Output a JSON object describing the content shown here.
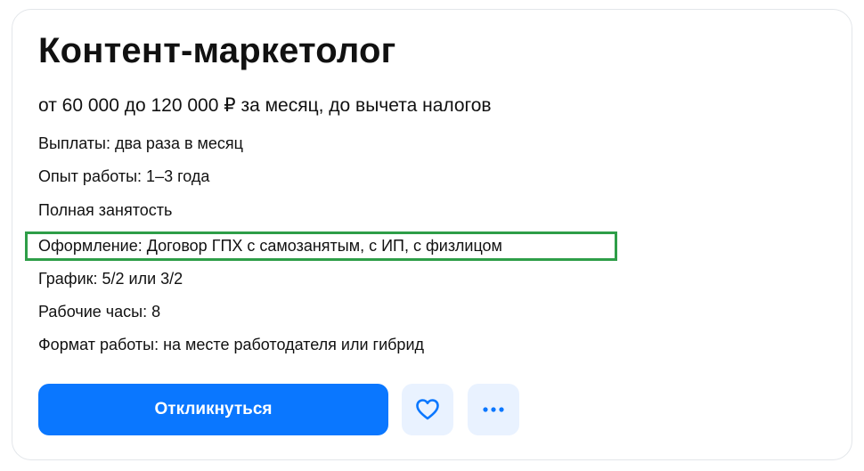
{
  "vacancy": {
    "title": "Контент-маркетолог",
    "salary": "от 60 000 до 120 000 ₽ за месяц, до вычета налогов",
    "details": [
      "Выплаты: два раза в месяц",
      "Опыт работы: 1–3 года",
      "Полная занятость",
      "Оформление: Договор ГПХ с самозанятым, с ИП, с физлицом",
      "График: 5/2 или 3/2",
      "Рабочие часы: 8",
      "Формат работы: на месте работодателя или гибрид"
    ],
    "highlighted_detail_index": 3
  },
  "actions": {
    "respond_label": "Откликнуться",
    "favorite_icon": "heart-icon",
    "more_icon": "more-horizontal-icon"
  },
  "colors": {
    "accent": "#0a77ff",
    "icon_button_bg": "#e9f2ff",
    "highlight_border": "#2e9e48",
    "text": "#111111"
  }
}
